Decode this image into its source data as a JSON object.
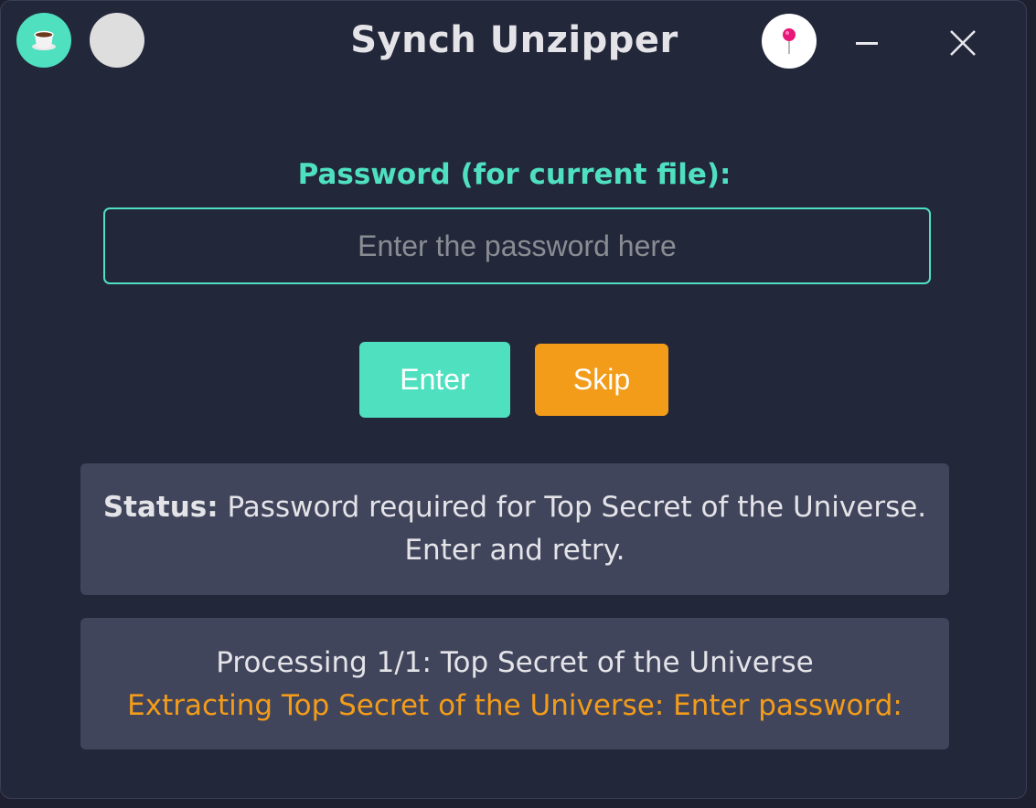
{
  "window": {
    "title": "Synch Unzipper"
  },
  "titlebar": {
    "left_buttons": [
      {
        "icon": "coffee-icon",
        "color": "#4fe0c0"
      },
      {
        "icon": "blank-circle",
        "color": "#dedede"
      }
    ],
    "pin_icon": "pin-icon",
    "minimize_icon": "minimize-icon",
    "close_icon": "close-icon"
  },
  "password": {
    "label": "Password (for current file):",
    "placeholder": "Enter the password here",
    "value": ""
  },
  "actions": {
    "enter_label": "Enter",
    "skip_label": "Skip"
  },
  "status": {
    "label": "Status:",
    "message": " Password required for Top Secret of the Universe. Enter and retry."
  },
  "log": {
    "lines": [
      {
        "text": "Processing 1/1: Top Secret of the Universe",
        "level": "info"
      },
      {
        "text": "Extracting Top Secret of the Universe: Enter password:",
        "level": "warn"
      }
    ]
  },
  "colors": {
    "accent": "#4fe0c0",
    "warning": "#f29c1a",
    "background": "#23273a",
    "panel": "#41455c",
    "pin": "#e8187a"
  }
}
